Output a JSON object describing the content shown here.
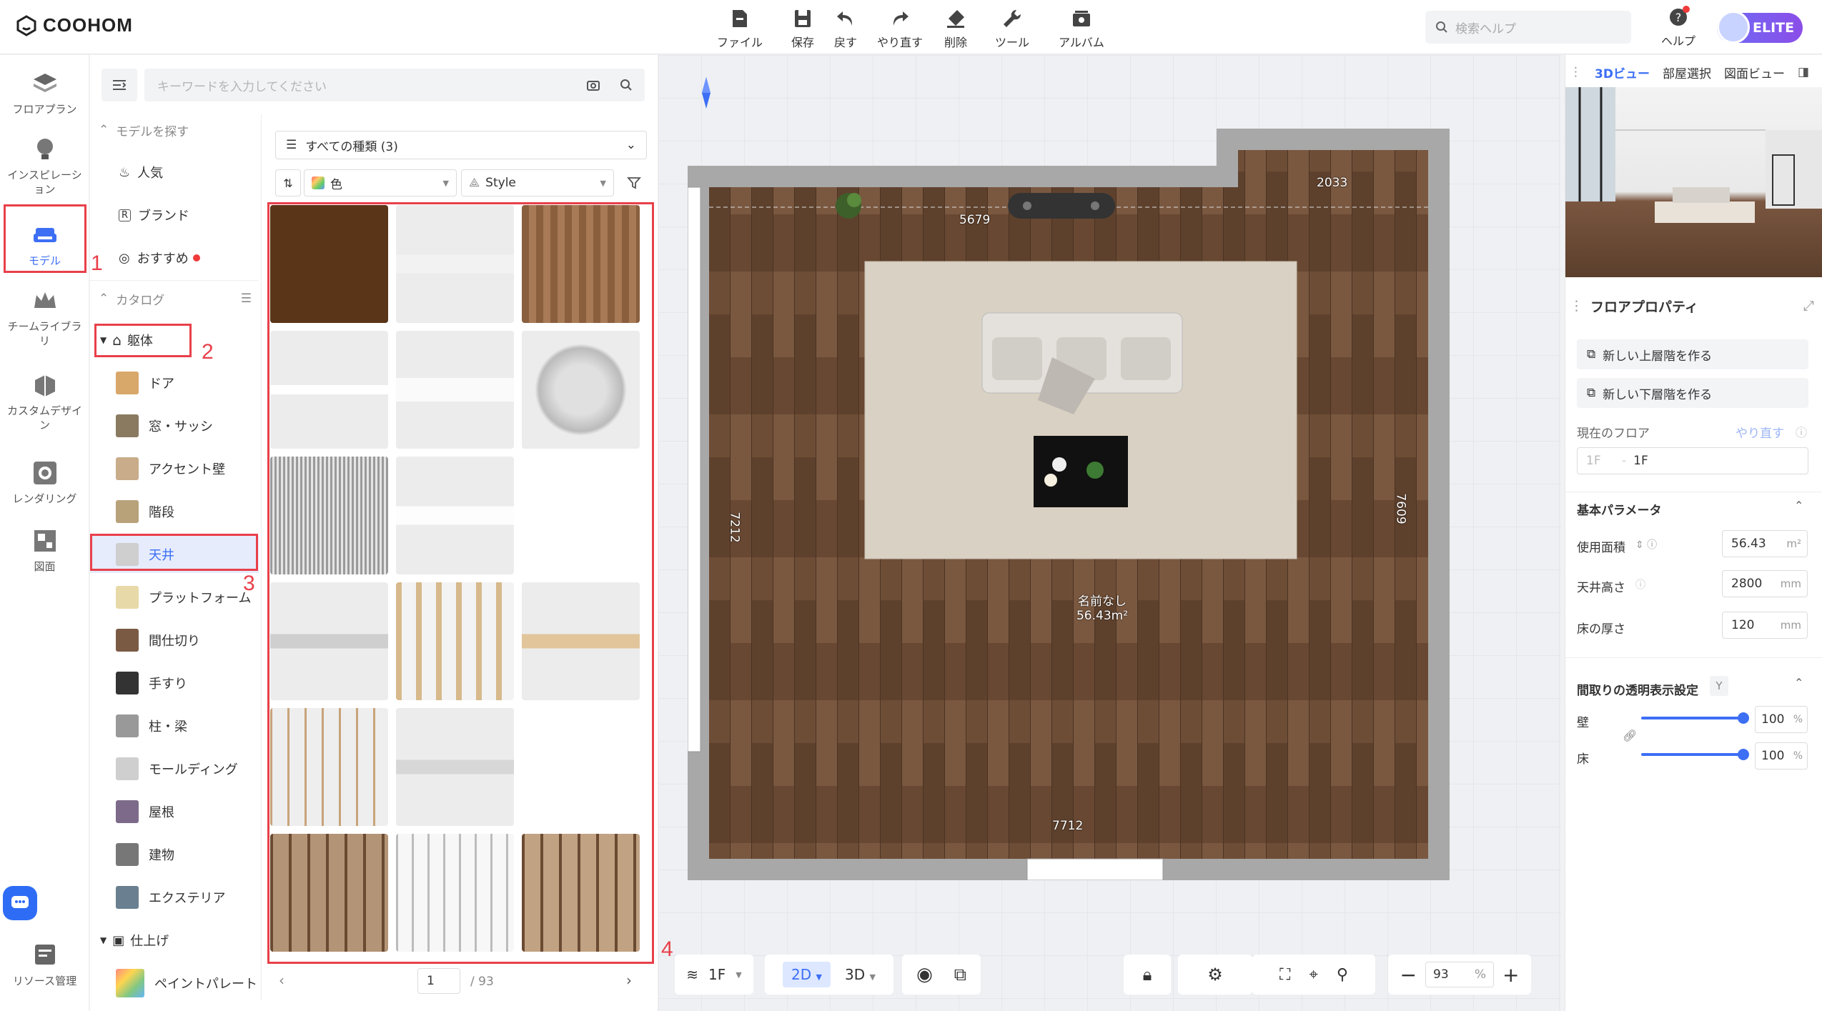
{
  "app": {
    "brand": "COOHOM"
  },
  "toolbar": {
    "items": [
      {
        "label": "ファイル",
        "icon": "file-icon"
      },
      {
        "label": "保存",
        "icon": "save-icon"
      },
      {
        "label": "戻す",
        "icon": "undo-icon"
      },
      {
        "label": "やり直す",
        "icon": "redo-icon"
      },
      {
        "label": "削除",
        "icon": "eraser-icon"
      },
      {
        "label": "ツール",
        "icon": "wrench-icon"
      },
      {
        "label": "アルバム",
        "icon": "album-icon"
      }
    ]
  },
  "header_right": {
    "search_placeholder": "検索ヘルプ",
    "help_label": "ヘルプ",
    "plan_badge": "ELITE"
  },
  "left_nav": {
    "items": [
      {
        "label": "フロアプラン"
      },
      {
        "label": "インスピレーション"
      },
      {
        "label": "モデル"
      },
      {
        "label": "チームライブラリ"
      },
      {
        "label": "カスタムデザイン"
      },
      {
        "label": "レンダリング"
      },
      {
        "label": "図面"
      },
      {
        "label": "リソース管理"
      }
    ]
  },
  "model_panel": {
    "search_placeholder": "キーワードを入力してください",
    "find_models_header": "モデルを探す",
    "find_items": [
      "人気",
      "ブランド",
      "おすすめ"
    ],
    "catalog_header": "カタログ",
    "group_structure": "躯体",
    "structure_items": [
      "ドア",
      "窓・サッシ",
      "アクセント壁",
      "階段",
      "天井",
      "プラットフォーム",
      "間仕切り",
      "手すり",
      "柱・梁",
      "モールディング",
      "屋根",
      "建物",
      "エクステリア"
    ],
    "group_finish": "仕上げ",
    "finish_items": [
      "ペイントパレート"
    ],
    "filter_type": "すべての種類 (3)",
    "filter_color": "色",
    "filter_style": "Style",
    "page_current": "1",
    "page_total": "/ 93"
  },
  "annotations": [
    "1",
    "2",
    "3",
    "4"
  ],
  "floorplan": {
    "dimensions": {
      "top": "5679",
      "top_right": "2033",
      "left": "7212",
      "right": "7609",
      "bottom": "7712"
    },
    "room_name": "名前なし",
    "room_area": "56.43m²"
  },
  "bottom_controls": {
    "floor": "1F",
    "view_2d": "2D",
    "view_3d": "3D",
    "zoom": "93",
    "zoom_unit": "%"
  },
  "right_panel": {
    "tabs": [
      "3Dビュー",
      "部屋選択",
      "図面ビュー"
    ],
    "section_title": "フロアプロパティ",
    "btn_upper": "新しい上層階を作る",
    "btn_lower": "新しい下層階を作る",
    "current_floor_label": "現在のフロア",
    "redo_label": "やり直す",
    "floor_prefix": "1F",
    "floor_value": "1F",
    "basic_params": "基本パラメータ",
    "area_label": "使用面積",
    "area_value": "56.43",
    "area_unit": "m²",
    "ceiling_label": "天井高さ",
    "ceiling_value": "2800",
    "ceiling_unit": "mm",
    "floor_thick_label": "床の厚さ",
    "floor_thick_value": "120",
    "floor_thick_unit": "mm",
    "transparency_title": "間取りの透明表示設定",
    "transparency_key": "Y",
    "wall_label": "壁",
    "wall_value": "100",
    "floor_label": "床",
    "floor_value_pct": "100",
    "pct": "%",
    "wall_level": 1.0,
    "floor_level": 1.0
  }
}
